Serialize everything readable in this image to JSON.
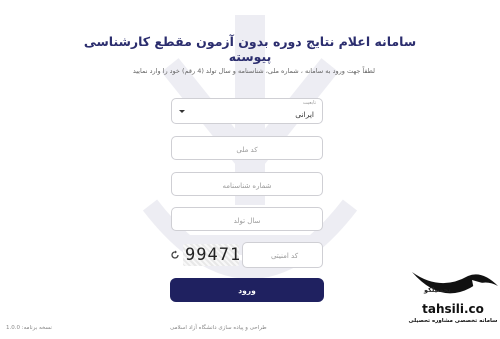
{
  "header": {
    "title": "سامانه اعلام نتایج دوره بدون آزمون مقطع کارشناسی پیوسته",
    "hint": "لطفاً جهت ورود به سامانه ، شماره ملی، شناسنامه و سال تولد (4 رقم) خود را وارد نمایید"
  },
  "form": {
    "nationality": {
      "label": "تابعیت",
      "value": "ایرانی"
    },
    "national_code": {
      "placeholder": "کد ملی"
    },
    "id_number": {
      "placeholder": "شماره شناسنامه"
    },
    "birth_year": {
      "placeholder": "سال تولد"
    },
    "captcha": {
      "placeholder": "کد امنیتی",
      "image_text": "99471"
    },
    "submit_label": "ورود"
  },
  "footer": {
    "version": "نسخه برنامه: 1.0.0",
    "credit": "طراحی و پیاده سازی دانشگاه آزاد اسلامی"
  },
  "watermark": {
    "name": "تحصیلکو",
    "brand": "tahsili.co",
    "tagline": "سامانه تخصصی مشاوره تحصیلی"
  }
}
